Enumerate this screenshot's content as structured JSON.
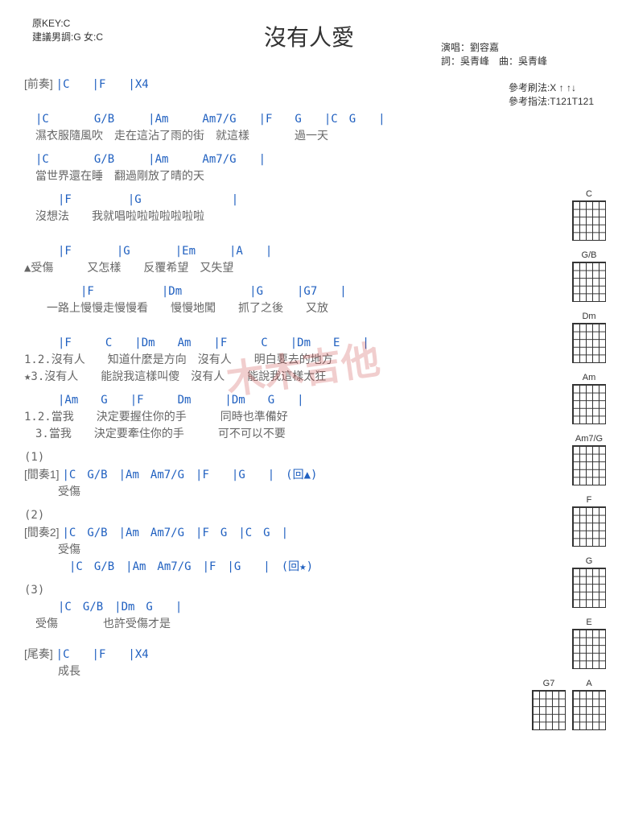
{
  "header": {
    "original_key": "原KEY:C",
    "suggest_key": "建議男調:G 女:C",
    "title": "沒有人愛",
    "performer": "演唱：劉容嘉",
    "credits": "詞：吳青峰　曲：吳青峰"
  },
  "refs": {
    "strum": "參考刷法:X ↑ ↑↓",
    "finger": "參考指法:T121T121"
  },
  "intro": {
    "label": "[前奏]",
    "chords": "|C　　|F　　|X4"
  },
  "v1a": {
    "chords": "　|C　　　　G/B　　　|Am　　　Am7/G　　|F　　G　　|C　G　　|",
    "lyric": "　濕衣服隨風吹　走在這沾了雨的街　就這樣　　　　過一天"
  },
  "v1b": {
    "chords": "　|C　　　　G/B　　　|Am　　　Am7/G　　|",
    "lyric": "　當世界還在睡　翻過剛放了晴的天"
  },
  "v1c": {
    "chords": "　　　|F　　　　　|G　　　　　　　　|",
    "lyric": "　沒想法　　我就唱啦啦啦啦啦啦啦"
  },
  "pre": {
    "chords": "　　　|F　　　　|G　　　　|Em　　　|A　　|",
    "lyric": "▲受傷　　　又怎樣　　反覆希望　又失望",
    "chords2": "　　　　　|F　　　　　　|Dm　　　　　　|G　　　|G7　　|",
    "lyric2": "　　一路上慢慢走慢慢看　　慢慢地闖　　抓了之後　　又放"
  },
  "chorus": {
    "chords": "　　　|F　　　C　　|Dm　　Am　　|F　　　C　　|Dm　　E　　|",
    "lyric1": "1.2.沒有人　　知道什麼是方向　沒有人　　明白要去的地方",
    "lyric2": "★3.沒有人　　能說我這樣叫傻　沒有人　　能說我這樣太狂",
    "chords3": "　　　|Am　　G　　|F　　　Dm　　　|Dm　　G　　|",
    "lyric3": "1.2.當我　　決定要握住你的手　　　同時也準備好",
    "lyric4": "　3.當我　　決定要牽住你的手　　　可不可以不要"
  },
  "i1": {
    "num": "(1)",
    "label": "[間奏1]",
    "chords": "|C　G/B　|Am　Am7/G　|F　　|G　　|　(回▲)",
    "lyric": "　　　受傷"
  },
  "i2": {
    "num": "(2)",
    "label": "[間奏2]",
    "chords": "|C　G/B　|Am　Am7/G　|F　G　|C　G　|",
    "lyric": "　　　受傷",
    "chords2": "　　　　|C　G/B　|Am　Am7/G　|F　|G　　|　(回★)"
  },
  "i3": {
    "num": "(3)",
    "chords": "　　　|C　G/B　|Dm　G　　|",
    "lyric": "　受傷　　　　也許受傷才是"
  },
  "outro": {
    "label": "[尾奏]",
    "chords": "|C　　|F　　|X4",
    "lyric": "　　　成長"
  },
  "diagrams": [
    "C",
    "G/B",
    "Dm",
    "Am",
    "Am7/G",
    "F",
    "G",
    "E",
    "G7",
    "A"
  ],
  "watermark": "木木吉他"
}
